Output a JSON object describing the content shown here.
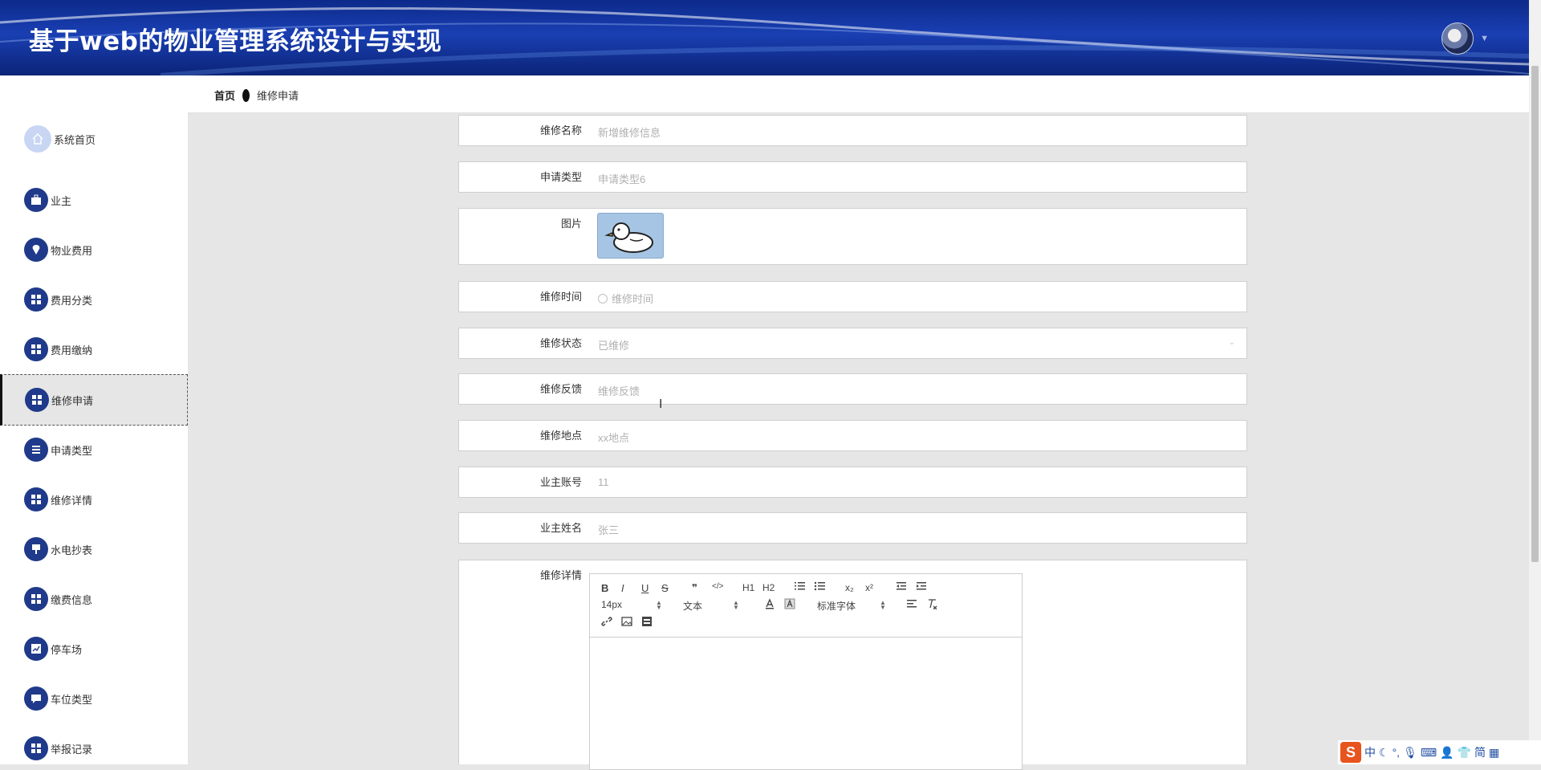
{
  "app": {
    "title": "基于web的物业管理系统设计与实现"
  },
  "header": {
    "avatar_icon": "user-avatar",
    "dropdown_icon": "caret-down-icon"
  },
  "breadcrumb": {
    "home": "首页",
    "current": "维修申请"
  },
  "sidebar": {
    "items": [
      {
        "label": "系统首页",
        "icon": "home-icon"
      },
      {
        "label": "业主",
        "icon": "briefcase-icon"
      },
      {
        "label": "物业费用",
        "icon": "location-icon"
      },
      {
        "label": "费用分类",
        "icon": "grid-icon"
      },
      {
        "label": "费用缴纳",
        "icon": "grid-icon"
      },
      {
        "label": "维修申请",
        "icon": "grid-icon",
        "active": true
      },
      {
        "label": "申请类型",
        "icon": "list-icon"
      },
      {
        "label": "维修详情",
        "icon": "grid-icon"
      },
      {
        "label": "水电抄表",
        "icon": "stamp-icon"
      },
      {
        "label": "缴费信息",
        "icon": "grid-icon"
      },
      {
        "label": "停车场",
        "icon": "chart-icon"
      },
      {
        "label": "车位类型",
        "icon": "chat-icon"
      },
      {
        "label": "举报记录",
        "icon": "grid-icon"
      }
    ]
  },
  "form": {
    "name": {
      "label": "维修名称",
      "value": "新增维修信息"
    },
    "type": {
      "label": "申请类型",
      "value": "申请类型6"
    },
    "image": {
      "label": "图片"
    },
    "time": {
      "label": "维修时间",
      "placeholder": "维修时间"
    },
    "status": {
      "label": "维修状态",
      "value": "已维修"
    },
    "feedback": {
      "label": "维修反馈",
      "placeholder": "维修反馈"
    },
    "location": {
      "label": "维修地点",
      "value": "xx地点"
    },
    "owner_account": {
      "label": "业主账号",
      "value": "11"
    },
    "owner_name": {
      "label": "业主姓名",
      "value": "张三"
    },
    "details": {
      "label": "维修详情"
    }
  },
  "editor": {
    "row1": {
      "bold": "B",
      "italic": "I",
      "underline": "U",
      "strike": "S",
      "quote": "❞",
      "code": "</>",
      "h1": "H1",
      "h2": "H2",
      "sub": "x₂",
      "sup": "x²"
    },
    "font_size": "14px",
    "header_select": "文本",
    "font_family": "标准字体"
  },
  "tray": {
    "ime_logo": "S",
    "ime_mode": "中",
    "simplified": "简"
  },
  "colors": {
    "header": "#1a3fb3",
    "accent": "#1f3a8a",
    "sidebar_bg": "#ffffff",
    "content_bg": "#e6e6e6"
  }
}
